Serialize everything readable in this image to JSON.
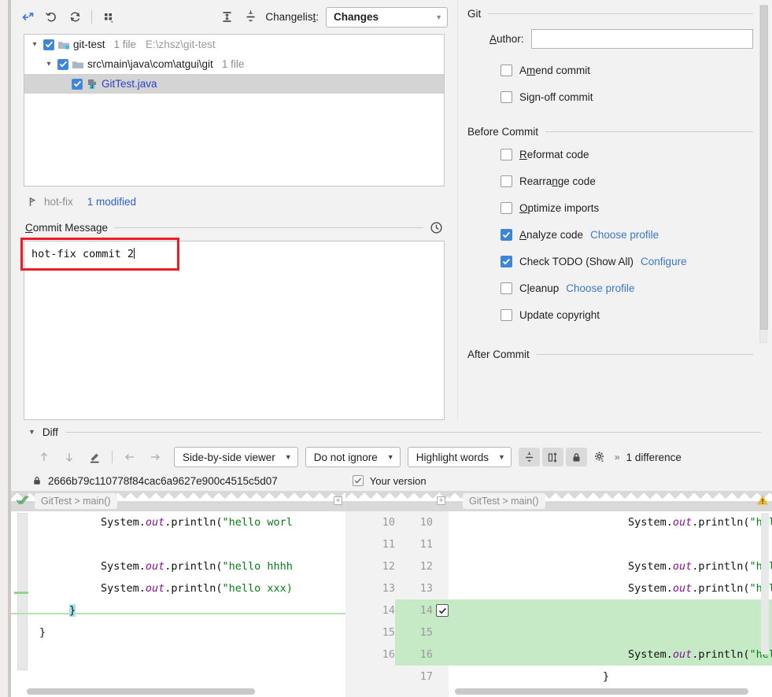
{
  "toolbar": {
    "icons": [
      {
        "name": "collapse-into-icon",
        "title": "Move to Another Changelist"
      },
      {
        "name": "rollback-icon",
        "title": "Rollback"
      },
      {
        "name": "refresh-icon",
        "title": "Refresh"
      },
      {
        "name": "group-by-icon",
        "title": "Group By"
      }
    ],
    "expand_all": "expand-all-icon",
    "collapse_all": "collapse-all-icon",
    "changelist_label": "Changelist:",
    "changelist_mnemonic": "t",
    "changelist_value": "Changes"
  },
  "file_tree": {
    "rows": [
      {
        "level": 0,
        "twisty": "▾",
        "checked": true,
        "icon": "module-folder-icon",
        "name": "git-test",
        "meta": "1 file",
        "path": "E:\\zhsz\\git-test",
        "selected": false,
        "is_link": false
      },
      {
        "level": 1,
        "twisty": "▾",
        "checked": true,
        "icon": "folder-icon",
        "name": "src\\main\\java\\com\\atgui\\git",
        "meta": "1 file",
        "path": "",
        "selected": false,
        "is_link": false
      },
      {
        "level": 2,
        "twisty": "",
        "checked": true,
        "icon": "java-file-icon",
        "name": "GitTest.java",
        "meta": "",
        "path": "",
        "selected": true,
        "is_link": true
      }
    ]
  },
  "branch_bar": {
    "icon": "branch-icon",
    "branch": "hot-fix",
    "modified": "1 modified"
  },
  "commit_message": {
    "label": "Commit Message",
    "label_mnemonic": "C",
    "history_icon": "clock-history-icon",
    "value": "hot-fix commit 2",
    "annotation_color": "#ee1c25"
  },
  "options_panel": {
    "groups": [
      {
        "title": "Git",
        "author_label": "Author:",
        "author_mnemonic": "A",
        "author_value": "",
        "author_placeholder": "",
        "checkboxes": [
          {
            "label": "Amend commit",
            "mnemonic": "m",
            "checked": false,
            "link": ""
          },
          {
            "label": "Sign-off commit",
            "mnemonic": "g",
            "checked": false,
            "link": ""
          }
        ]
      },
      {
        "title": "Before Commit",
        "checkboxes": [
          {
            "label": "Reformat code",
            "mnemonic": "R",
            "checked": false,
            "link": ""
          },
          {
            "label": "Rearrange code",
            "mnemonic": "n",
            "checked": false,
            "link": ""
          },
          {
            "label": "Optimize imports",
            "mnemonic": "O",
            "checked": false,
            "link": ""
          },
          {
            "label": "Analyze code",
            "mnemonic": "A",
            "checked": true,
            "link": "Choose profile"
          },
          {
            "label": "Check TODO (Show All)",
            "mnemonic": "",
            "checked": true,
            "link": "Configure"
          },
          {
            "label": "Cleanup",
            "mnemonic": "l",
            "checked": false,
            "link": "Choose profile"
          },
          {
            "label": "Update copyright",
            "mnemonic": "",
            "checked": false,
            "link": ""
          }
        ]
      },
      {
        "title": "After Commit",
        "checkboxes": []
      }
    ],
    "accent_color": "#3d85d8",
    "link_color": "#3b77c7"
  },
  "diff": {
    "section_label": "Diff",
    "nav_icons": [
      {
        "name": "previous-difference-icon"
      },
      {
        "name": "next-difference-icon"
      },
      {
        "name": "edit-source-icon"
      },
      {
        "name": "accept-left-icon"
      },
      {
        "name": "accept-right-icon"
      }
    ],
    "viewer_mode": "Side-by-side viewer",
    "ignore_mode": "Do not ignore",
    "highlight_mode": "Highlight words",
    "toggle_icons": [
      {
        "name": "collapse-unchanged-fragments-icon",
        "pressed": true
      },
      {
        "name": "synchronize-scrolling-icon",
        "pressed": true
      },
      {
        "name": "lock-icon",
        "pressed": true
      },
      {
        "name": "settings-gear-icon",
        "pressed": false
      }
    ],
    "overflow": "»",
    "difference_count": "1 difference",
    "revision_icon": "lock-icon",
    "revision_hash": "2666b79c110778f84cac6a9627e900c4515c5d07",
    "your_version_label": "Your version",
    "your_version_checked": true,
    "left_breadcrumb": "GitTest > main()",
    "right_breadcrumb": "GitTest > main()",
    "left_lines": [
      {
        "gutter": "10",
        "code": "            System.out.println(\"hello worl",
        "added": false
      },
      {
        "gutter": "11",
        "code": "",
        "added": false
      },
      {
        "gutter": "12",
        "code": "            System.out.println(\"hello hhhh",
        "added": false
      },
      {
        "gutter": "13",
        "code": "            System.out.println(\"hello xxx)",
        "added": false
      },
      {
        "gutter": "14",
        "code": "    }",
        "added": false
      },
      {
        "gutter": "15",
        "code": "}",
        "added": false
      },
      {
        "gutter": "16",
        "code": "",
        "added": false
      }
    ],
    "right_lines": [
      {
        "gutter": "10",
        "code": "            System.out.println(\"hello world!",
        "added": false,
        "checkbox": false
      },
      {
        "gutter": "11",
        "code": "",
        "added": false,
        "checkbox": false
      },
      {
        "gutter": "12",
        "code": "            System.out.println(\"hello hhhh",
        "added": false,
        "checkbox": false
      },
      {
        "gutter": "13",
        "code": "            System.out.println(\"hello xxxxx",
        "added": false,
        "checkbox": false
      },
      {
        "gutter": "14",
        "code": "",
        "added": true,
        "checkbox": true
      },
      {
        "gutter": "15",
        "code": "",
        "added": true,
        "checkbox": false
      },
      {
        "gutter": "16",
        "code": "            System.out.println(\"hello hot-fi",
        "added": true,
        "checkbox": false
      },
      {
        "gutter": "17",
        "code": "    }",
        "added": false,
        "checkbox": false
      }
    ]
  }
}
